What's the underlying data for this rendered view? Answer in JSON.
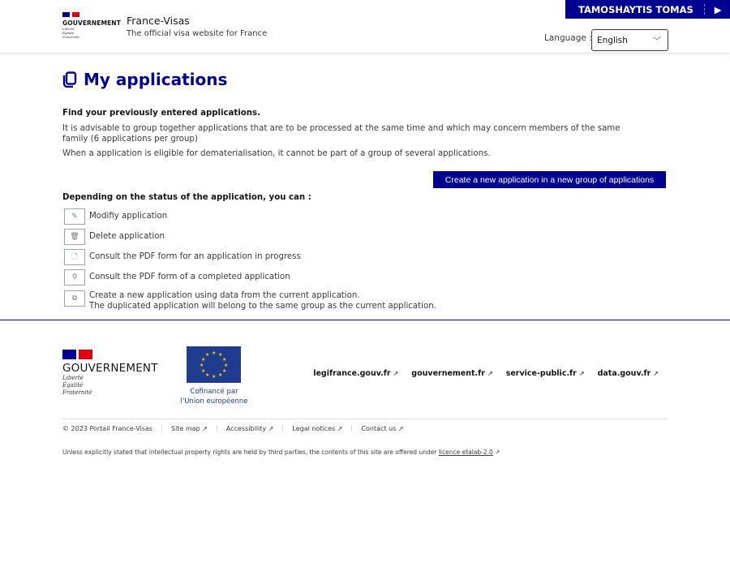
{
  "header": {
    "gov_logo": "GOUVERNEMENT",
    "devise": [
      "Liberté",
      "Égalité",
      "Fraternité"
    ],
    "site_title": "France-Visas",
    "site_subtitle": "The official visa website for France",
    "user_name": "TAMOSHAYTIS TOMAS",
    "language_label": "Language :",
    "language_value": "English"
  },
  "main": {
    "title": "My applications",
    "intro_bold": "Find your previously entered applications.",
    "intro_1": "It is advisable to group together applications that are to be processed at the same time and which may concern members of the same family (6 applications per group)",
    "intro_2": "When a application is eligible for dematerialisation, it cannot be part of a group of several applications.",
    "create_button": "Create a new application in a new group of applications",
    "legend_title": "Depending on the status of the application, you can :",
    "legend": [
      {
        "icon": "pencil-icon",
        "label": "Modifiy application"
      },
      {
        "icon": "trash-icon",
        "label": "Delete application"
      },
      {
        "icon": "pdf-icon",
        "label": "Consult the PDF form for an application in progress"
      },
      {
        "icon": "magnifier-icon",
        "label": "Consult the PDF form of a completed application"
      },
      {
        "icon": "duplicate-icon",
        "label": "Create a new application using data from the current application.",
        "label2": "The duplicated application will belong to the same group as the current application."
      }
    ]
  },
  "footer": {
    "gov_logo": "GOUVERNEMENT",
    "devise": [
      "Liberté",
      "Égalité",
      "Fraternité"
    ],
    "eu_caption_1": "Cofinancé par",
    "eu_caption_2": "l'Union européenne",
    "links": [
      "legifrance.gouv.fr",
      "gouvernement.fr",
      "service-public.fr",
      "data.gouv.fr"
    ],
    "bottom_links": [
      "© 2023 Portail France-Visas",
      "Site map",
      "Accessibility",
      "Legal notices",
      "Contact us"
    ],
    "license_text": "Unless explicitly stated that intellectual property rights are held by third parties, the contents of this site are offered under",
    "license_link": "licence etalab-2.0"
  },
  "colors": {
    "primary": "#000091",
    "flag_blue": "#000091",
    "flag_red": "#e1000f"
  }
}
